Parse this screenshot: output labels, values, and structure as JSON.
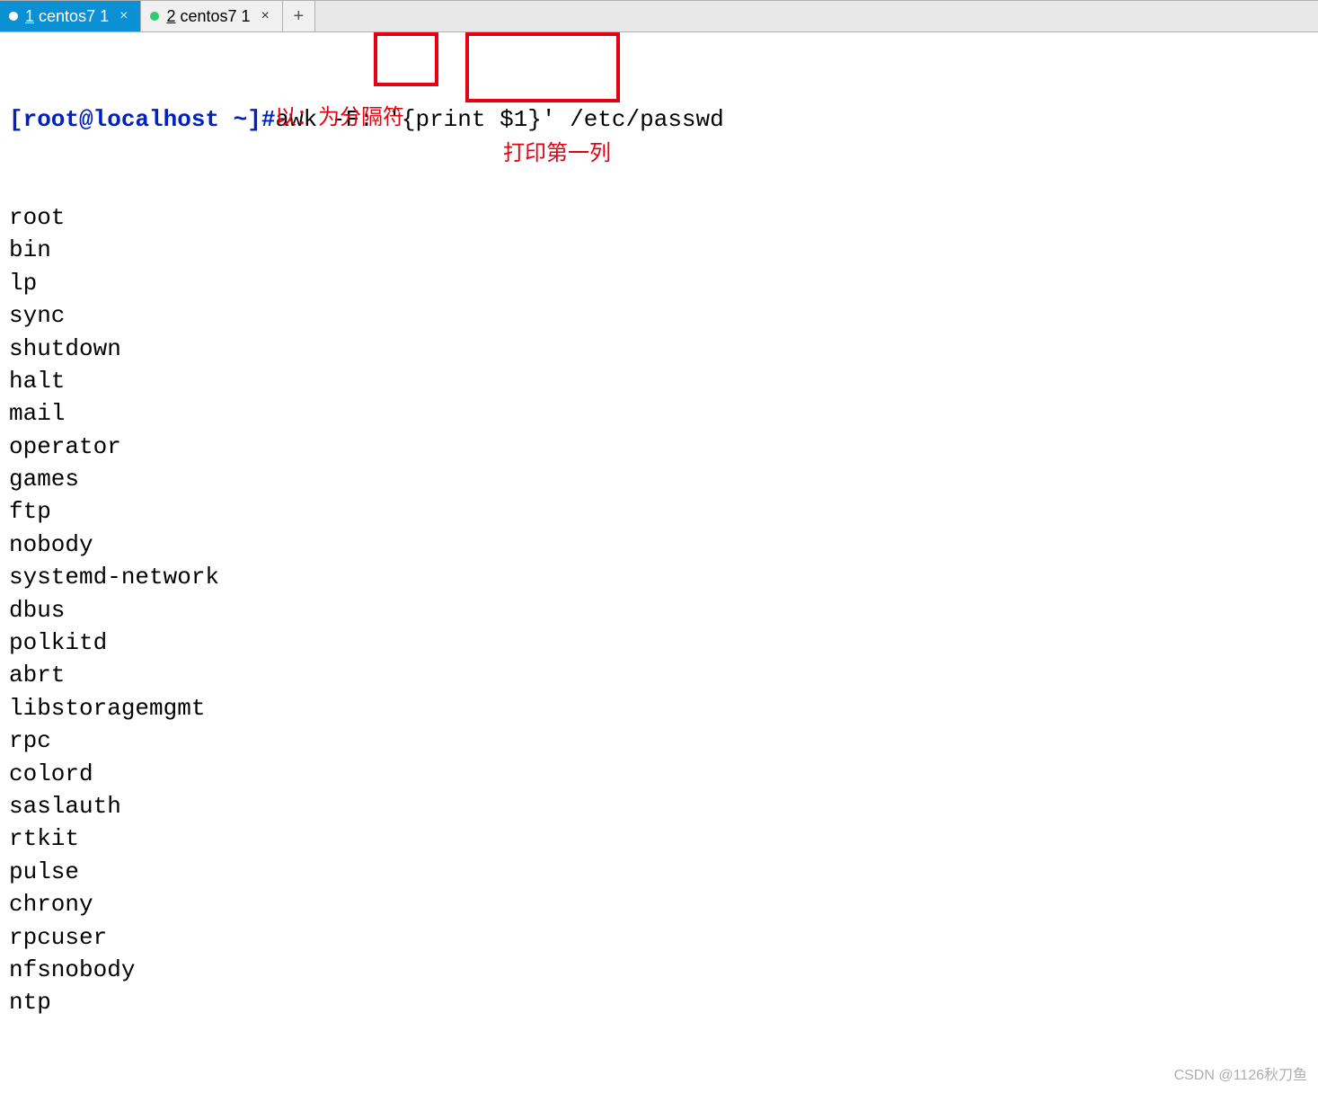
{
  "tabs": {
    "active": {
      "num": "1",
      "name": "centos7 1",
      "close": "×"
    },
    "inactive": {
      "num": "2",
      "name": "centos7 1",
      "close": "×"
    },
    "add": "+"
  },
  "terminal": {
    "prompt": "[root@localhost ~]#",
    "command": "awk -F: '{print $1}' /etc/passwd",
    "output": [
      "root",
      "bin",
      "lp",
      "sync",
      "shutdown",
      "halt",
      "mail",
      "operator",
      "games",
      "ftp",
      "nobody",
      "systemd-network",
      "dbus",
      "polkitd",
      "abrt",
      "libstoragemgmt",
      "rpc",
      "colord",
      "saslauth",
      "rtkit",
      "pulse",
      "chrony",
      "rpcuser",
      "nfsnobody",
      "ntp"
    ]
  },
  "annotations": {
    "label1": "以：为分隔符",
    "label2": "打印第一列"
  },
  "watermark": "CSDN @1126秋刀鱼"
}
